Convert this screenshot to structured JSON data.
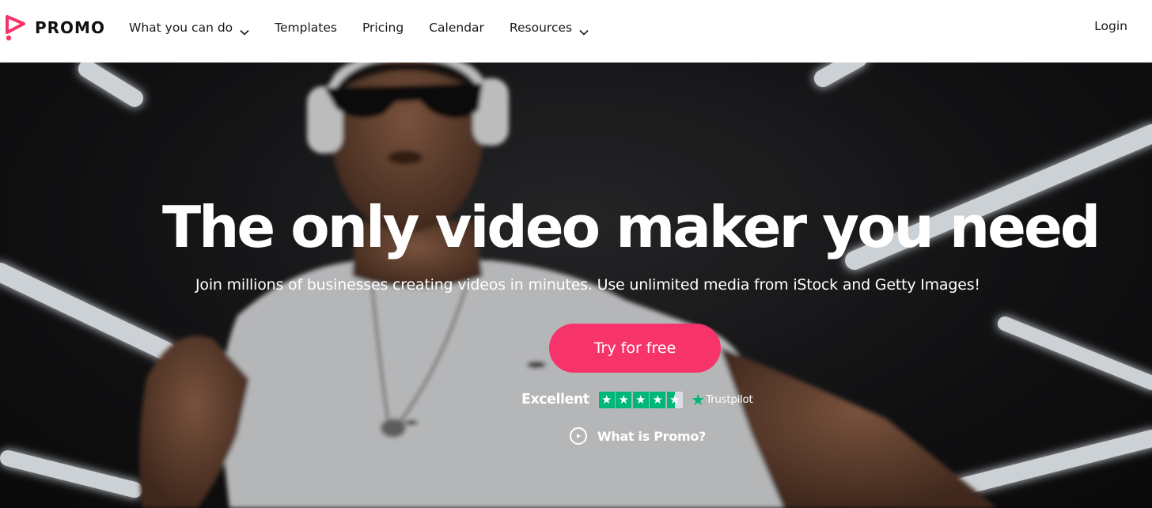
{
  "nav": {
    "brand": "PROMO",
    "items": [
      {
        "label": "What you can do",
        "has_dropdown": true
      },
      {
        "label": "Templates",
        "has_dropdown": false
      },
      {
        "label": "Pricing",
        "has_dropdown": false
      },
      {
        "label": "Calendar",
        "has_dropdown": false
      },
      {
        "label": "Resources",
        "has_dropdown": true
      }
    ],
    "login": "Login"
  },
  "hero": {
    "title": "The only video maker you need",
    "subtitle": "Join millions of businesses creating videos in minutes. Use unlimited media from iStock and Getty Images!",
    "cta": "Try for free",
    "rating": {
      "label": "Excellent",
      "stars": 4.5,
      "provider": "Trustpilot"
    },
    "video_link": "What is Promo?"
  },
  "colors": {
    "accent": "#f7346a",
    "trustpilot_green": "#00b67a",
    "nav_text": "#1a1a1a",
    "hero_text": "#ffffff"
  },
  "icons": {
    "logo": "promo-play-logo-icon",
    "dropdown": "chevron-down-icon",
    "rating_star": "star-icon",
    "play": "play-circle-icon"
  }
}
